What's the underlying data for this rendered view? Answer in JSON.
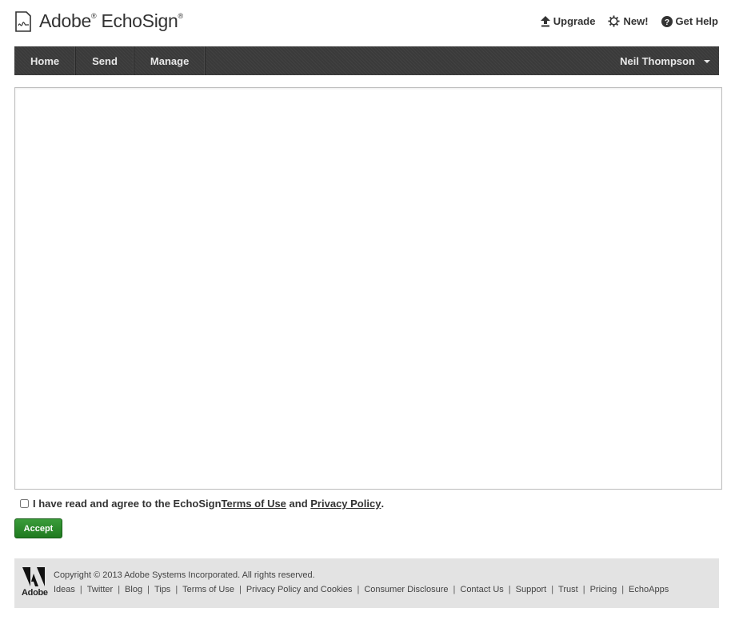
{
  "brand": {
    "name": "Adobe",
    "product": "EchoSign",
    "reg": "®"
  },
  "top_links": {
    "upgrade": "Upgrade",
    "new": "New!",
    "help": "Get Help"
  },
  "nav": {
    "items": [
      "Home",
      "Send",
      "Manage"
    ],
    "user": "Neil Thompson"
  },
  "agreement": {
    "text_before": "I have read and agree to the EchoSign ",
    "terms_link": "Terms of Use",
    "middle": " and ",
    "privacy_link": "Privacy Policy",
    "end": ".",
    "checked": false
  },
  "accept_button": "Accept",
  "footer": {
    "logo_text": "Adobe",
    "copyright": "Copyright © 2013 Adobe Systems Incorporated. All rights reserved.",
    "links": [
      "Ideas",
      "Twitter",
      "Blog",
      "Tips",
      "Terms of Use",
      "Privacy Policy and Cookies",
      "Consumer Disclosure",
      "Contact Us",
      "Support",
      "Trust",
      "Pricing",
      "EchoApps"
    ]
  },
  "colors": {
    "navbar": "#3a3a3a",
    "accept": "#2a8a2a",
    "footer_bg": "#e3e3e3"
  }
}
